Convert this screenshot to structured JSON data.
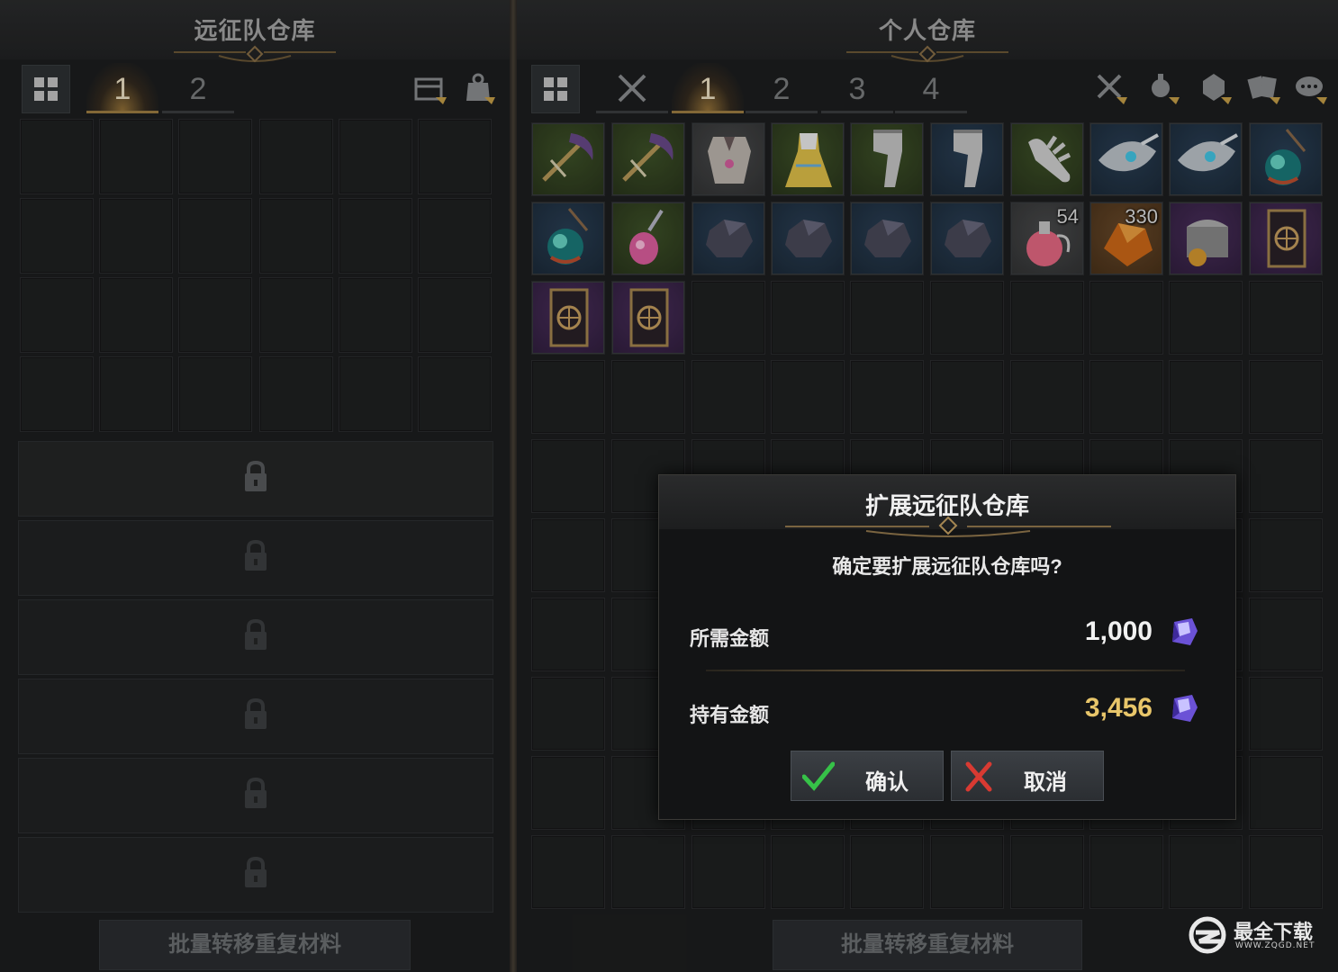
{
  "left_panel": {
    "title": "远征队仓库",
    "tabs": [
      "1",
      "2"
    ],
    "active_tab": "1",
    "locked_rows": 6,
    "bottom_button": "批量转移重复材料",
    "icons": [
      "grid-view-icon",
      "chest-transfer-icon",
      "bag-transfer-icon",
      "lock-icon"
    ]
  },
  "right_panel": {
    "title": "个人仓库",
    "tabs": [
      "1",
      "2",
      "3",
      "4"
    ],
    "active_tab": "1",
    "bottom_button": "批量转移重复材料",
    "icons": [
      "grid-view-icon",
      "crossed-swords-icon",
      "crossed-tools-icon",
      "potion-transfer-icon",
      "gem-transfer-icon",
      "card-transfer-icon",
      "chat-transfer-icon"
    ],
    "items": [
      {
        "name": "scythe-weapon",
        "rarity": "green"
      },
      {
        "name": "scythe-weapon",
        "rarity": "green"
      },
      {
        "name": "chest-armor",
        "rarity": "gray"
      },
      {
        "name": "dress-outfit",
        "rarity": "green"
      },
      {
        "name": "leg-armor",
        "rarity": "green"
      },
      {
        "name": "leg-armor",
        "rarity": "blue"
      },
      {
        "name": "glove",
        "rarity": "green"
      },
      {
        "name": "mask-helmet",
        "rarity": "blue"
      },
      {
        "name": "mask-helmet",
        "rarity": "blue"
      },
      {
        "name": "orb-necklace",
        "rarity": "blue"
      },
      {
        "name": "orb-necklace",
        "rarity": "blue"
      },
      {
        "name": "pink-earring",
        "rarity": "green"
      },
      {
        "name": "ore-stone",
        "rarity": "blue"
      },
      {
        "name": "ore-stone",
        "rarity": "blue"
      },
      {
        "name": "ore-stone",
        "rarity": "blue"
      },
      {
        "name": "ore-stone",
        "rarity": "blue"
      },
      {
        "name": "health-potion",
        "rarity": "gray",
        "count": "54"
      },
      {
        "name": "amber-crystal",
        "rarity": "orange",
        "count": "330"
      },
      {
        "name": "treasure-chest",
        "rarity": "purple"
      },
      {
        "name": "tarot-card",
        "rarity": "purple"
      },
      {
        "name": "tarot-card",
        "rarity": "purple"
      },
      {
        "name": "tarot-card",
        "rarity": "purple"
      }
    ]
  },
  "dialog": {
    "title": "扩展远征队仓库",
    "question": "确定要扩展远征队仓库吗?",
    "required_label": "所需金额",
    "required_value": "1,000",
    "held_label": "持有金额",
    "held_value": "3,456",
    "confirm_label": "确认",
    "cancel_label": "取消",
    "colors": {
      "required": "#f2f2f2",
      "held": "#e8c66a"
    }
  },
  "watermark": {
    "text": "最全下载",
    "sub": "WWW.ZQGD.NET"
  }
}
